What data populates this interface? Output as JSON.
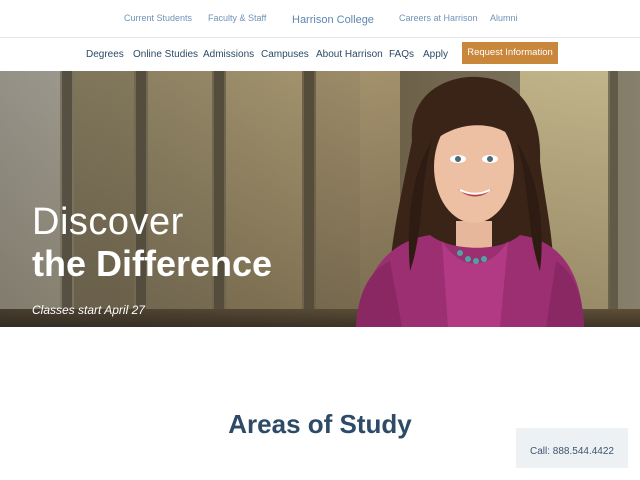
{
  "topbar": {
    "links": [
      "Current Students",
      "Faculty & Staff",
      "Careers at Harrison",
      "Alumni"
    ],
    "brand": "Harrison College"
  },
  "nav": {
    "items": [
      "Degrees",
      "Online Studies",
      "Admissions",
      "Campuses",
      "About Harrison",
      "FAQs",
      "Apply"
    ],
    "cta": "Request Information"
  },
  "hero": {
    "title_line1": "Discover",
    "title_line2": "the Difference",
    "subtitle": "Classes start April 27"
  },
  "section": {
    "title": "Areas of Study"
  },
  "call_widget": {
    "label": "Call: 888.544.4422"
  },
  "colors": {
    "link_blue": "#6f93b8",
    "nav_text": "#2c4a66",
    "cta_bg": "#c9873b",
    "heading": "#2d4a66"
  }
}
